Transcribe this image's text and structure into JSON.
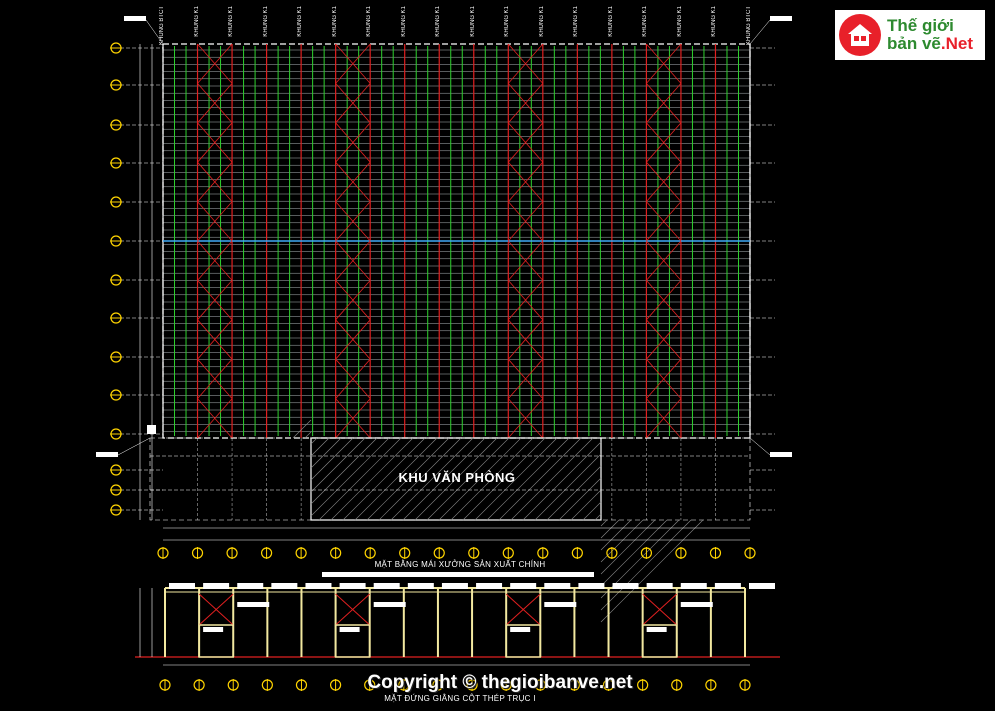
{
  "logo": {
    "line1": "Thế giới",
    "line2a": "bản vẽ",
    "line2b": ".Net"
  },
  "frame_labels": {
    "left": "KHUNG BTCT",
    "right": "KHUNG BTCT",
    "inner": [
      "KHUNG K1",
      "KHUNG K1",
      "KHUNG K1",
      "KHUNG K1",
      "KHUNG K1",
      "KHUNG K1",
      "KHUNG K1",
      "KHUNG K1",
      "KHUNG K1",
      "KHUNG K1",
      "KHUNG K1",
      "KHUNG K1",
      "KHUNG K1",
      "KHUNG K1",
      "KHUNG K1",
      "KHUNG K1"
    ]
  },
  "office_label": "KHU VĂN PHÒNG",
  "plan_title": "MẶT BẰNG MÁI XƯỞNG SẢN XUẤT CHÍNH",
  "elevation_title": "MẶT ĐỨNG GIẰNG CỘT THÉP TRỤC I",
  "copyright": "Copyright © thegioibanve.net",
  "colors": {
    "background": "#000000",
    "grid": "#ffffff",
    "purlin": "#2fd12f",
    "bracing": "#e02020",
    "axis_bubble": "#ffd400",
    "column": "#f2e8a0",
    "office_hatch": "#888888"
  }
}
